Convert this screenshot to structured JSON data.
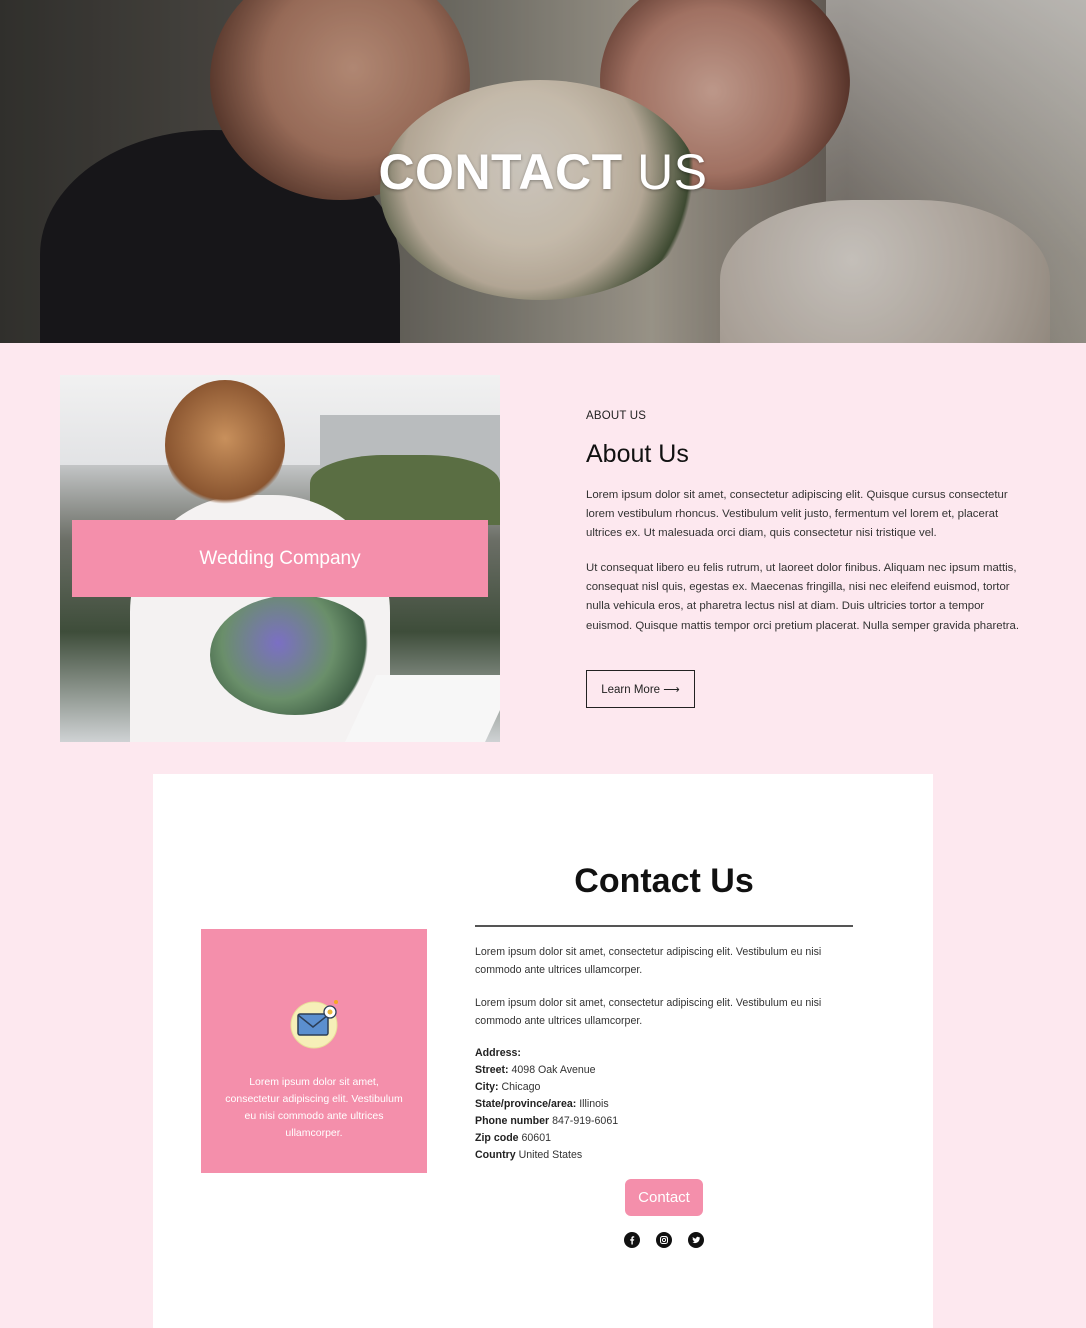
{
  "hero": {
    "title_bold": "CONTACT",
    "title_light": "US"
  },
  "about": {
    "image_banner": "Wedding Company",
    "eyebrow": "ABOUT US",
    "title": "About Us",
    "paragraph1": "Lorem ipsum dolor sit amet, consectetur adipiscing elit. Quisque cursus consectetur lorem vestibulum rhoncus. Vestibulum velit justo, fermentum vel lorem et, placerat ultrices ex. Ut malesuada orci diam, quis consectetur nisi tristique vel.",
    "paragraph2": "Ut consequat libero eu felis rutrum, ut laoreet dolor finibus. Aliquam nec ipsum mattis, consequat nisl quis, egestas ex. Maecenas fringilla, nisi nec eleifend euismod, tortor nulla vehicula eros, at pharetra lectus nisl at diam. Duis ultricies tortor a tempor euismod. Quisque mattis tempor orci pretium placerat. Nulla semper gravida pharetra.",
    "button_label": "Learn More ⟶"
  },
  "contact": {
    "title": "Contact Us",
    "box_icon": "mail-icon",
    "box_text": "Lorem ipsum dolor sit amet, consectetur adipiscing elit. Vestibulum eu nisi commodo ante ultrices ullamcorper.",
    "paragraph1": "Lorem ipsum dolor sit amet, consectetur adipiscing elit. Vestibulum eu nisi commodo ante ultrices ullamcorper.",
    "paragraph2": "Lorem ipsum dolor sit amet, consectetur adipiscing elit. Vestibulum eu nisi commodo ante ultrices ullamcorper.",
    "address_heading": "Address:",
    "street_label": "Street:",
    "street": "4098 Oak Avenue",
    "city_label": "City:",
    "city": "Chicago",
    "state_label": "State/province/area:",
    "state": "Illinois",
    "phone_label": "Phone number",
    "phone": "847-919-6061",
    "zip_label": "Zip code",
    "zip": "60601",
    "country_label": "Country",
    "country": "United States",
    "button_label": "Contact",
    "social_icons": [
      "facebook-icon",
      "instagram-icon",
      "twitter-icon"
    ]
  },
  "colors": {
    "page_bg": "#fde8ef",
    "accent_pink": "#f48fab",
    "card_bg": "#ffffff"
  }
}
